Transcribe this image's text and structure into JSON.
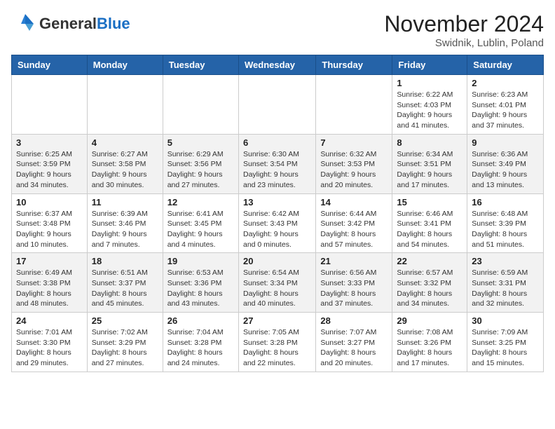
{
  "header": {
    "logo_general": "General",
    "logo_blue": "Blue",
    "month": "November 2024",
    "location": "Swidnik, Lublin, Poland"
  },
  "days_of_week": [
    "Sunday",
    "Monday",
    "Tuesday",
    "Wednesday",
    "Thursday",
    "Friday",
    "Saturday"
  ],
  "weeks": [
    [
      {
        "day": "",
        "info": ""
      },
      {
        "day": "",
        "info": ""
      },
      {
        "day": "",
        "info": ""
      },
      {
        "day": "",
        "info": ""
      },
      {
        "day": "",
        "info": ""
      },
      {
        "day": "1",
        "info": "Sunrise: 6:22 AM\nSunset: 4:03 PM\nDaylight: 9 hours and 41 minutes."
      },
      {
        "day": "2",
        "info": "Sunrise: 6:23 AM\nSunset: 4:01 PM\nDaylight: 9 hours and 37 minutes."
      }
    ],
    [
      {
        "day": "3",
        "info": "Sunrise: 6:25 AM\nSunset: 3:59 PM\nDaylight: 9 hours and 34 minutes."
      },
      {
        "day": "4",
        "info": "Sunrise: 6:27 AM\nSunset: 3:58 PM\nDaylight: 9 hours and 30 minutes."
      },
      {
        "day": "5",
        "info": "Sunrise: 6:29 AM\nSunset: 3:56 PM\nDaylight: 9 hours and 27 minutes."
      },
      {
        "day": "6",
        "info": "Sunrise: 6:30 AM\nSunset: 3:54 PM\nDaylight: 9 hours and 23 minutes."
      },
      {
        "day": "7",
        "info": "Sunrise: 6:32 AM\nSunset: 3:53 PM\nDaylight: 9 hours and 20 minutes."
      },
      {
        "day": "8",
        "info": "Sunrise: 6:34 AM\nSunset: 3:51 PM\nDaylight: 9 hours and 17 minutes."
      },
      {
        "day": "9",
        "info": "Sunrise: 6:36 AM\nSunset: 3:49 PM\nDaylight: 9 hours and 13 minutes."
      }
    ],
    [
      {
        "day": "10",
        "info": "Sunrise: 6:37 AM\nSunset: 3:48 PM\nDaylight: 9 hours and 10 minutes."
      },
      {
        "day": "11",
        "info": "Sunrise: 6:39 AM\nSunset: 3:46 PM\nDaylight: 9 hours and 7 minutes."
      },
      {
        "day": "12",
        "info": "Sunrise: 6:41 AM\nSunset: 3:45 PM\nDaylight: 9 hours and 4 minutes."
      },
      {
        "day": "13",
        "info": "Sunrise: 6:42 AM\nSunset: 3:43 PM\nDaylight: 9 hours and 0 minutes."
      },
      {
        "day": "14",
        "info": "Sunrise: 6:44 AM\nSunset: 3:42 PM\nDaylight: 8 hours and 57 minutes."
      },
      {
        "day": "15",
        "info": "Sunrise: 6:46 AM\nSunset: 3:41 PM\nDaylight: 8 hours and 54 minutes."
      },
      {
        "day": "16",
        "info": "Sunrise: 6:48 AM\nSunset: 3:39 PM\nDaylight: 8 hours and 51 minutes."
      }
    ],
    [
      {
        "day": "17",
        "info": "Sunrise: 6:49 AM\nSunset: 3:38 PM\nDaylight: 8 hours and 48 minutes."
      },
      {
        "day": "18",
        "info": "Sunrise: 6:51 AM\nSunset: 3:37 PM\nDaylight: 8 hours and 45 minutes."
      },
      {
        "day": "19",
        "info": "Sunrise: 6:53 AM\nSunset: 3:36 PM\nDaylight: 8 hours and 43 minutes."
      },
      {
        "day": "20",
        "info": "Sunrise: 6:54 AM\nSunset: 3:34 PM\nDaylight: 8 hours and 40 minutes."
      },
      {
        "day": "21",
        "info": "Sunrise: 6:56 AM\nSunset: 3:33 PM\nDaylight: 8 hours and 37 minutes."
      },
      {
        "day": "22",
        "info": "Sunrise: 6:57 AM\nSunset: 3:32 PM\nDaylight: 8 hours and 34 minutes."
      },
      {
        "day": "23",
        "info": "Sunrise: 6:59 AM\nSunset: 3:31 PM\nDaylight: 8 hours and 32 minutes."
      }
    ],
    [
      {
        "day": "24",
        "info": "Sunrise: 7:01 AM\nSunset: 3:30 PM\nDaylight: 8 hours and 29 minutes."
      },
      {
        "day": "25",
        "info": "Sunrise: 7:02 AM\nSunset: 3:29 PM\nDaylight: 8 hours and 27 minutes."
      },
      {
        "day": "26",
        "info": "Sunrise: 7:04 AM\nSunset: 3:28 PM\nDaylight: 8 hours and 24 minutes."
      },
      {
        "day": "27",
        "info": "Sunrise: 7:05 AM\nSunset: 3:28 PM\nDaylight: 8 hours and 22 minutes."
      },
      {
        "day": "28",
        "info": "Sunrise: 7:07 AM\nSunset: 3:27 PM\nDaylight: 8 hours and 20 minutes."
      },
      {
        "day": "29",
        "info": "Sunrise: 7:08 AM\nSunset: 3:26 PM\nDaylight: 8 hours and 17 minutes."
      },
      {
        "day": "30",
        "info": "Sunrise: 7:09 AM\nSunset: 3:25 PM\nDaylight: 8 hours and 15 minutes."
      }
    ]
  ]
}
